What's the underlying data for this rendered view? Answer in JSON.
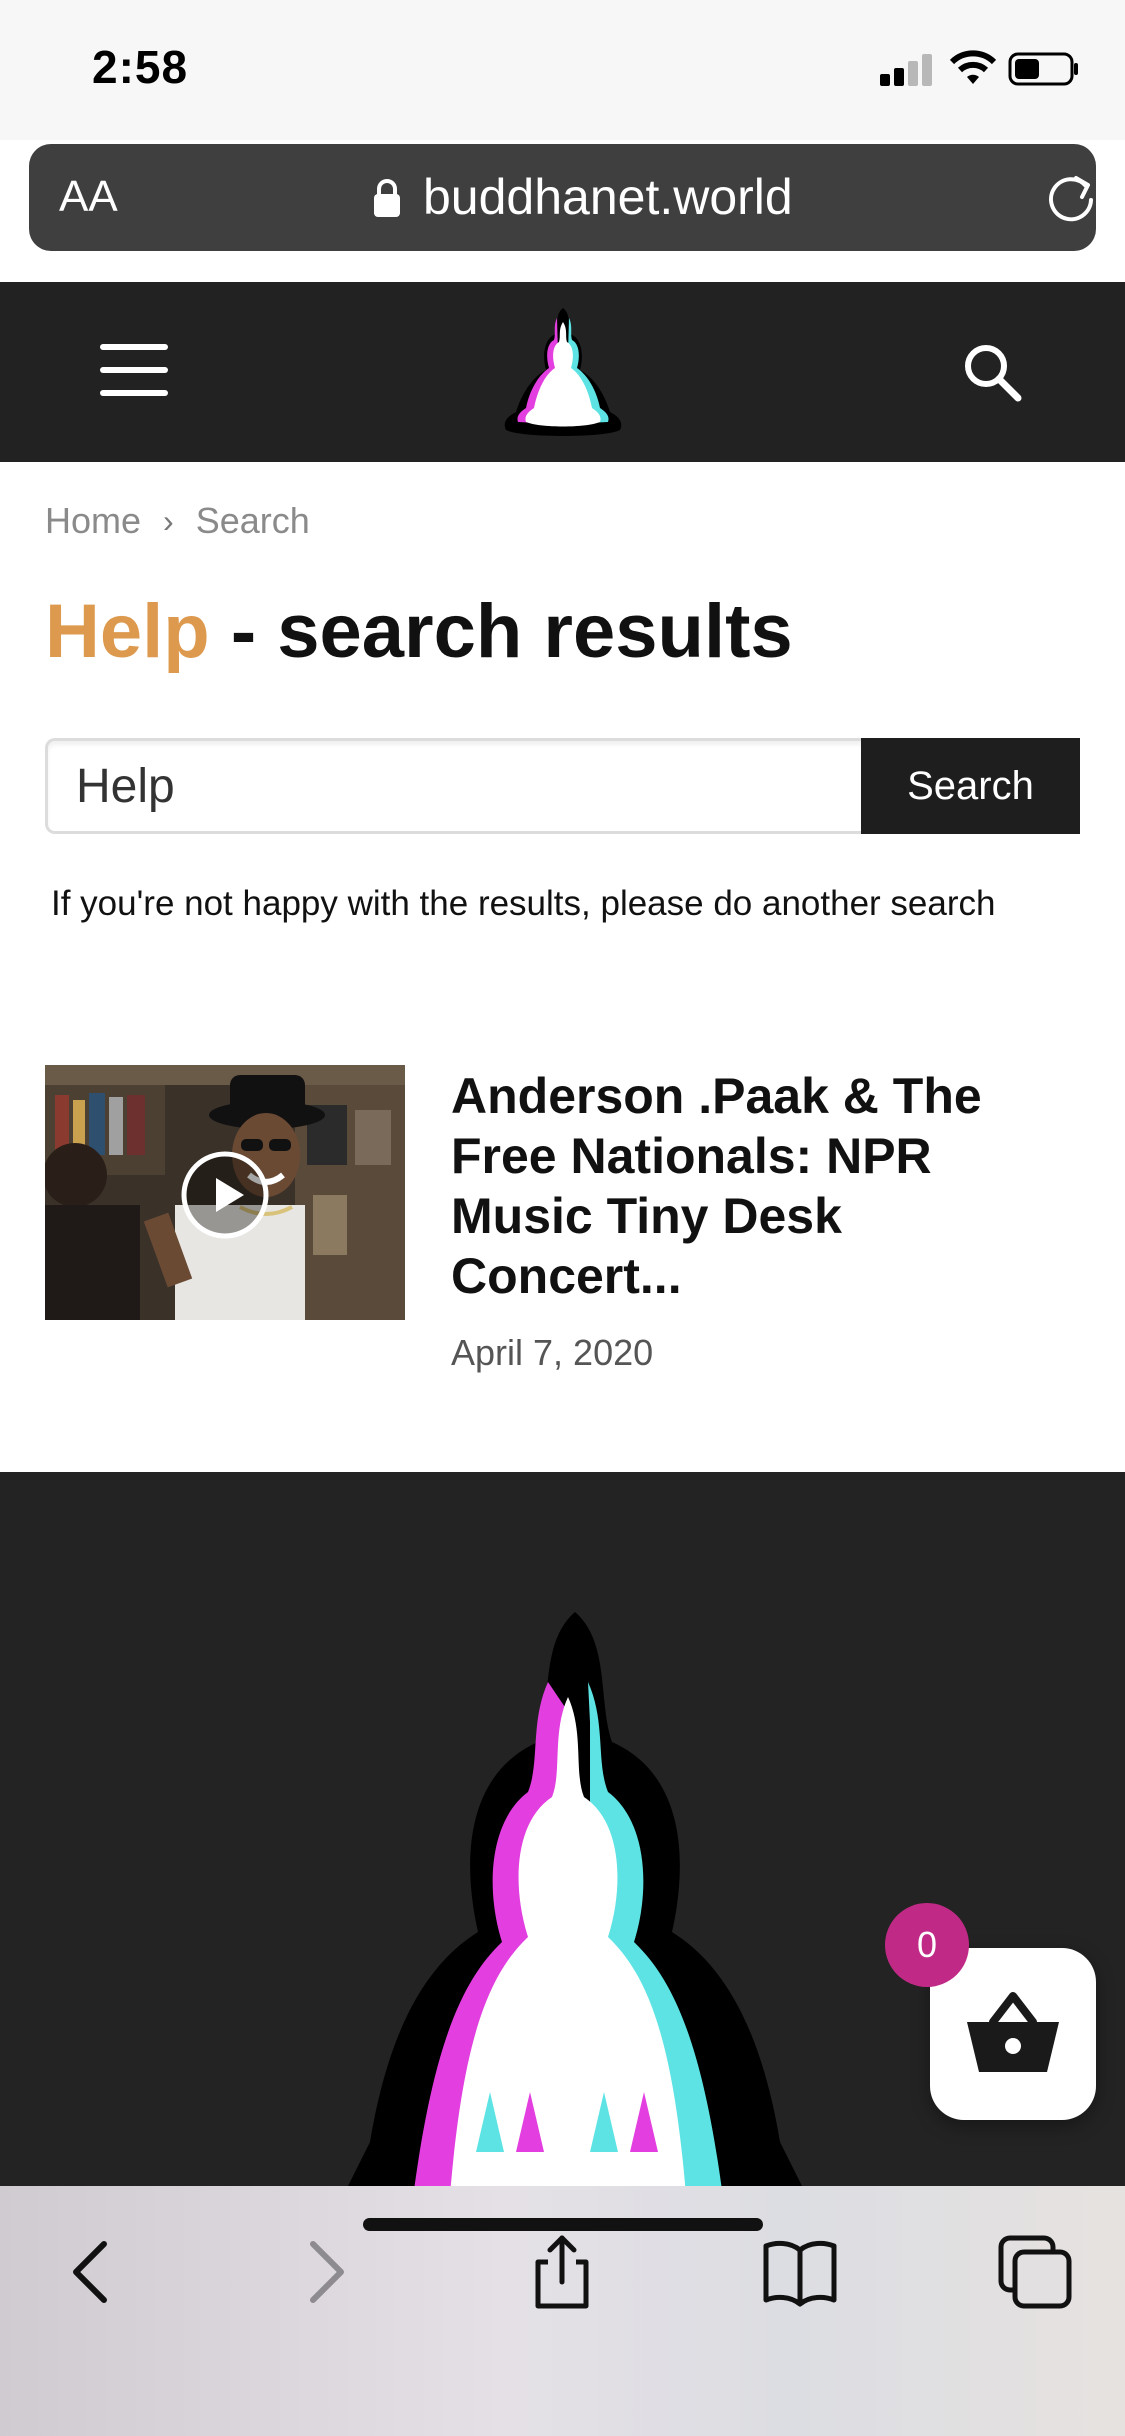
{
  "status_bar": {
    "time": "2:58"
  },
  "browser": {
    "text_size_label": "AA",
    "url": "buddhanet.world"
  },
  "breadcrumb": {
    "home": "Home",
    "separator": "›",
    "current": "Search"
  },
  "page": {
    "title_query": "Help",
    "title_suffix": " - search results"
  },
  "search": {
    "value": "Help",
    "button_label": "Search"
  },
  "hint_text": "If you're not happy with the results, please do another search",
  "results": [
    {
      "title": "Anderson .Paak & The Free Nationals: NPR Music Tiny Desk Concert...",
      "date": "April 7, 2020"
    }
  ],
  "cart": {
    "count": "0"
  },
  "colors": {
    "accent": "#dd9a4f",
    "header_bg": "#222222",
    "badge": "#c02a86"
  },
  "icons": {
    "menu": "hamburger-icon",
    "search": "search-icon",
    "cart": "basket-icon",
    "play": "play-icon"
  }
}
